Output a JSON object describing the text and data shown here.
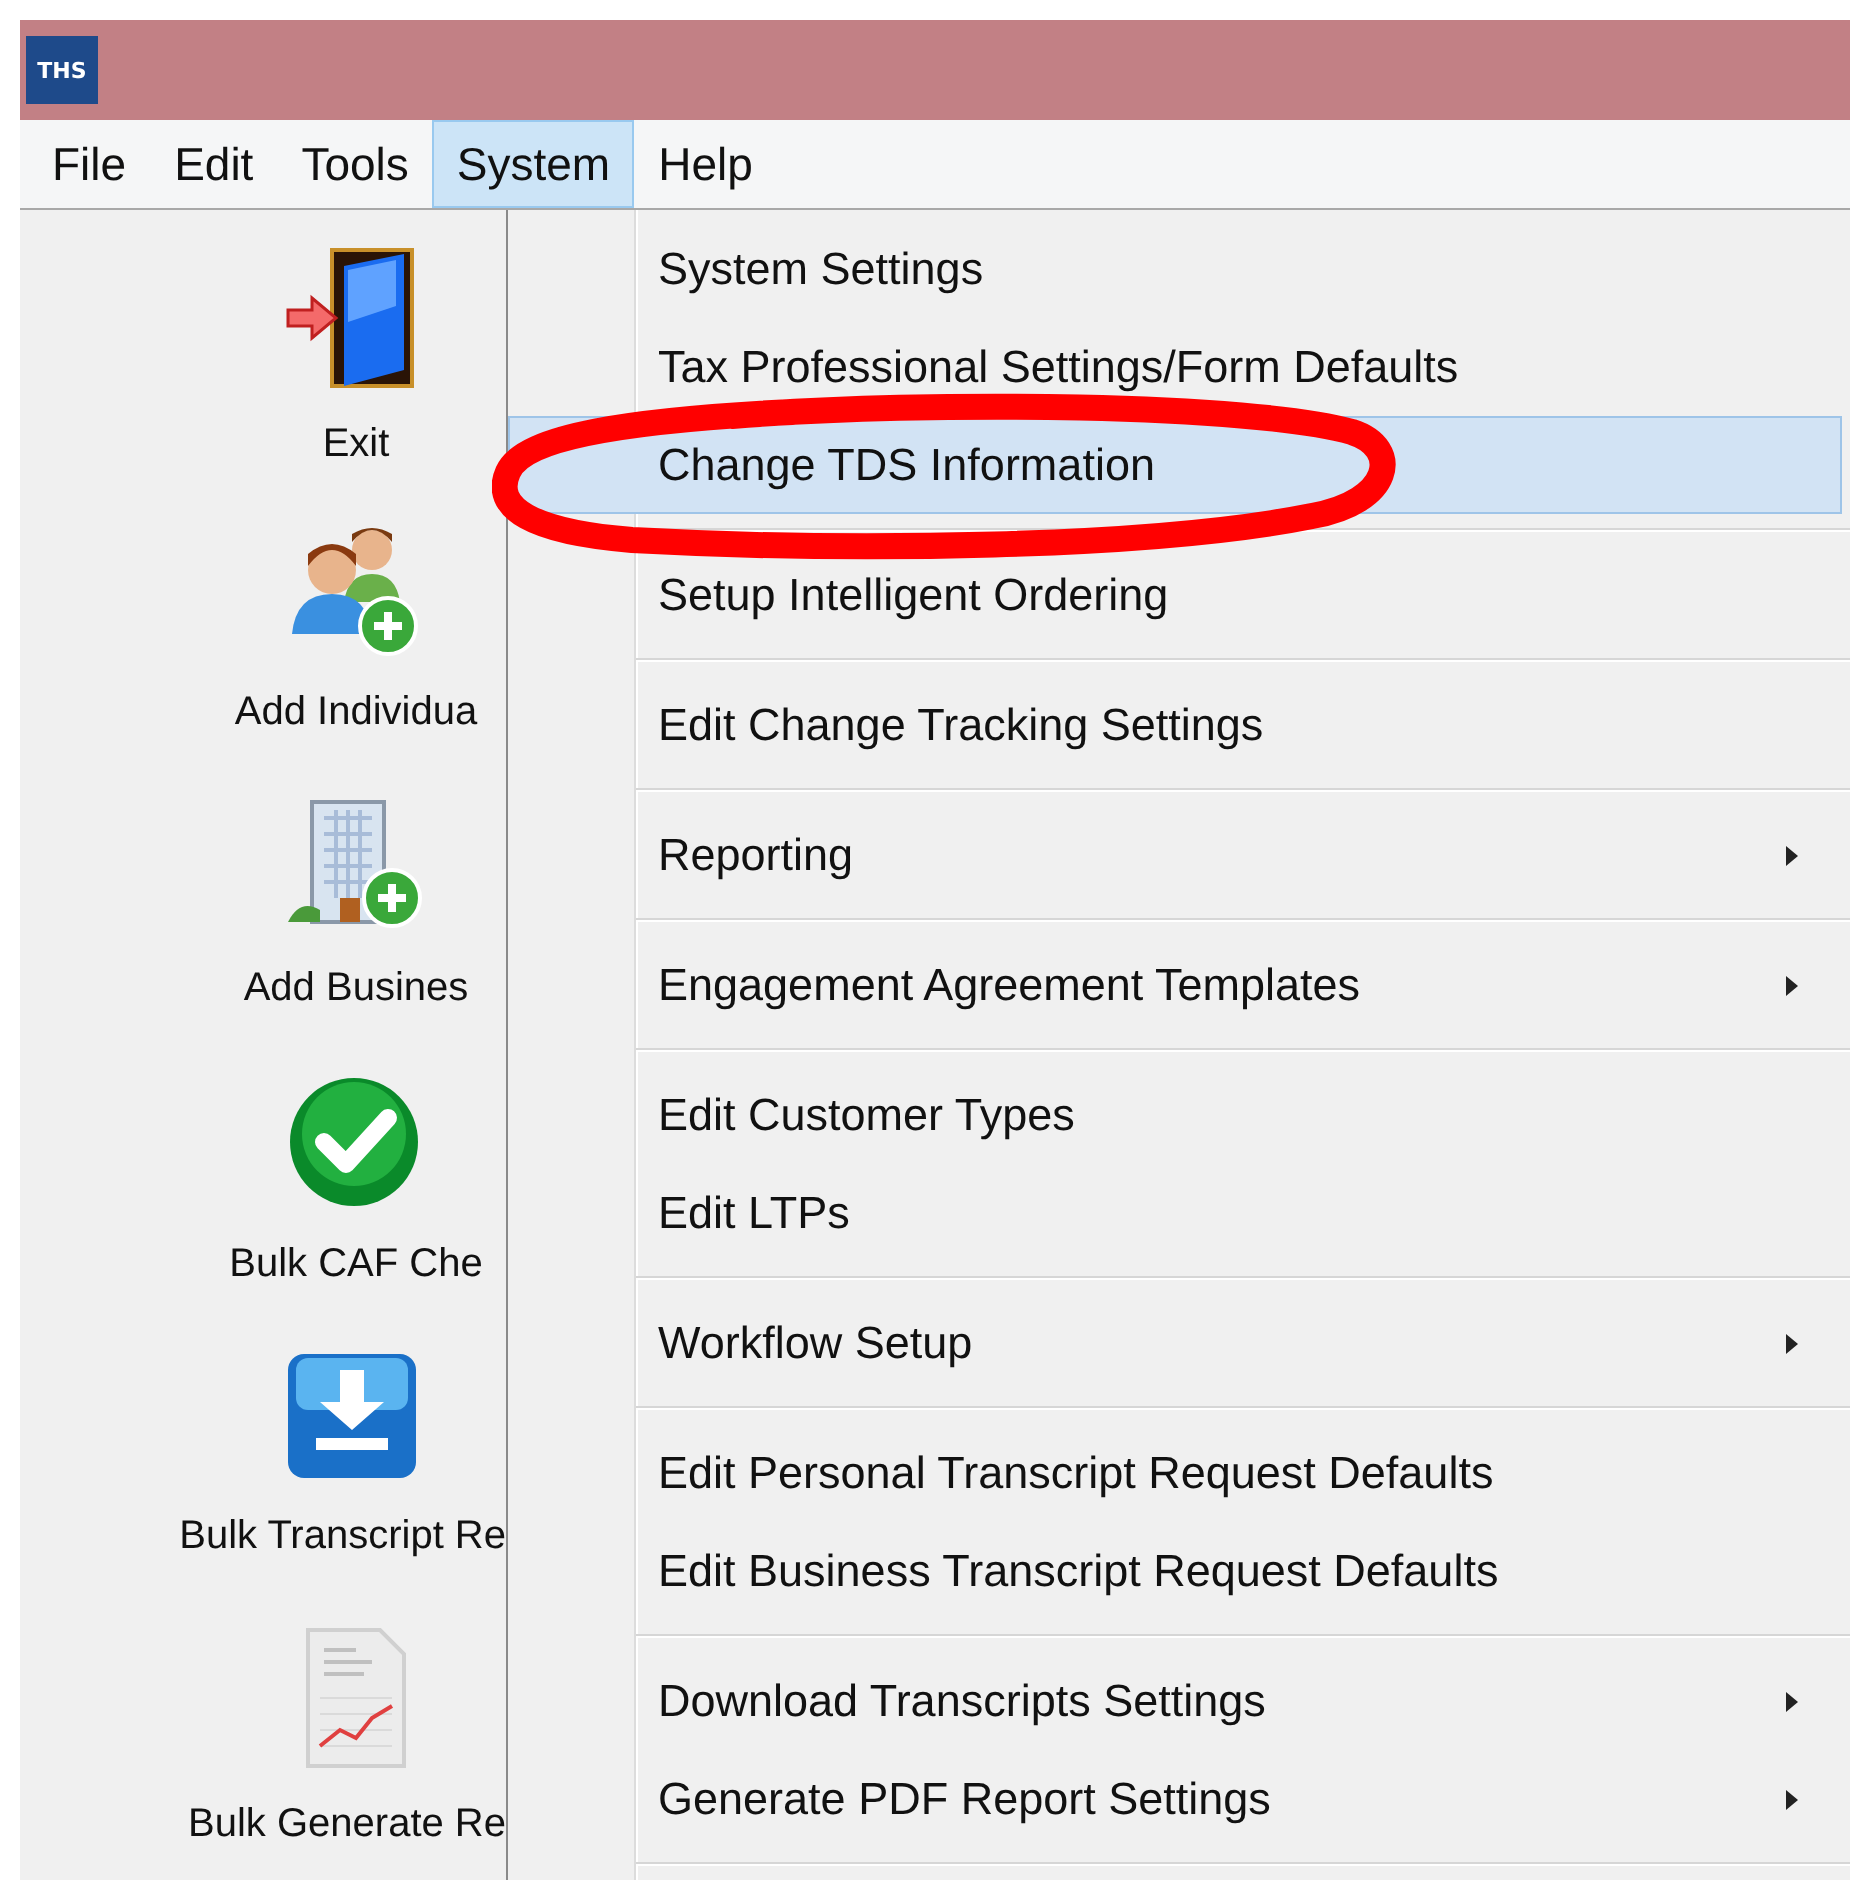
{
  "window": {
    "title_logo": "THS"
  },
  "menu_bar": [
    {
      "label": "File",
      "selected": false
    },
    {
      "label": "Edit",
      "selected": false
    },
    {
      "label": "Tools",
      "selected": false
    },
    {
      "label": "System",
      "selected": true
    },
    {
      "label": "Help",
      "selected": false
    }
  ],
  "toolbar": [
    {
      "label": "Exit",
      "kind": "exit"
    },
    {
      "label": "Add Individua",
      "kind": "people"
    },
    {
      "label": "Add Busines",
      "kind": "building"
    },
    {
      "label": "Bulk CAF Che",
      "kind": "check"
    },
    {
      "label": "Bulk Transcript Re",
      "kind": "download"
    },
    {
      "label": "Bulk Generate Re",
      "kind": "report"
    }
  ],
  "dropdown": {
    "groups": [
      {
        "items": [
          {
            "label": "System Settings",
            "submenu": false,
            "selected": false
          },
          {
            "label": "Tax Professional Settings/Form Defaults",
            "submenu": false,
            "selected": false
          },
          {
            "label": "Change TDS Information",
            "submenu": false,
            "selected": true
          }
        ]
      },
      {
        "items": [
          {
            "label": "Setup Intelligent Ordering",
            "submenu": false,
            "selected": false
          }
        ]
      },
      {
        "items": [
          {
            "label": "Edit Change Tracking Settings",
            "submenu": false,
            "selected": false
          }
        ]
      },
      {
        "items": [
          {
            "label": "Reporting",
            "submenu": true,
            "selected": false
          }
        ]
      },
      {
        "items": [
          {
            "label": "Engagement Agreement Templates",
            "submenu": true,
            "selected": false
          }
        ]
      },
      {
        "items": [
          {
            "label": "Edit Customer Types",
            "submenu": false,
            "selected": false
          },
          {
            "label": "Edit LTPs",
            "submenu": false,
            "selected": false
          }
        ]
      },
      {
        "items": [
          {
            "label": "Workflow Setup",
            "submenu": true,
            "selected": false
          }
        ]
      },
      {
        "items": [
          {
            "label": "Edit Personal Transcript Request Defaults",
            "submenu": false,
            "selected": false
          },
          {
            "label": "Edit Business Transcript Request Defaults",
            "submenu": false,
            "selected": false
          }
        ]
      },
      {
        "items": [
          {
            "label": "Download Transcripts Settings",
            "submenu": true,
            "selected": false
          },
          {
            "label": "Generate PDF Report Settings",
            "submenu": true,
            "selected": false
          }
        ]
      }
    ]
  },
  "annotation": {
    "kind": "ellipse"
  }
}
